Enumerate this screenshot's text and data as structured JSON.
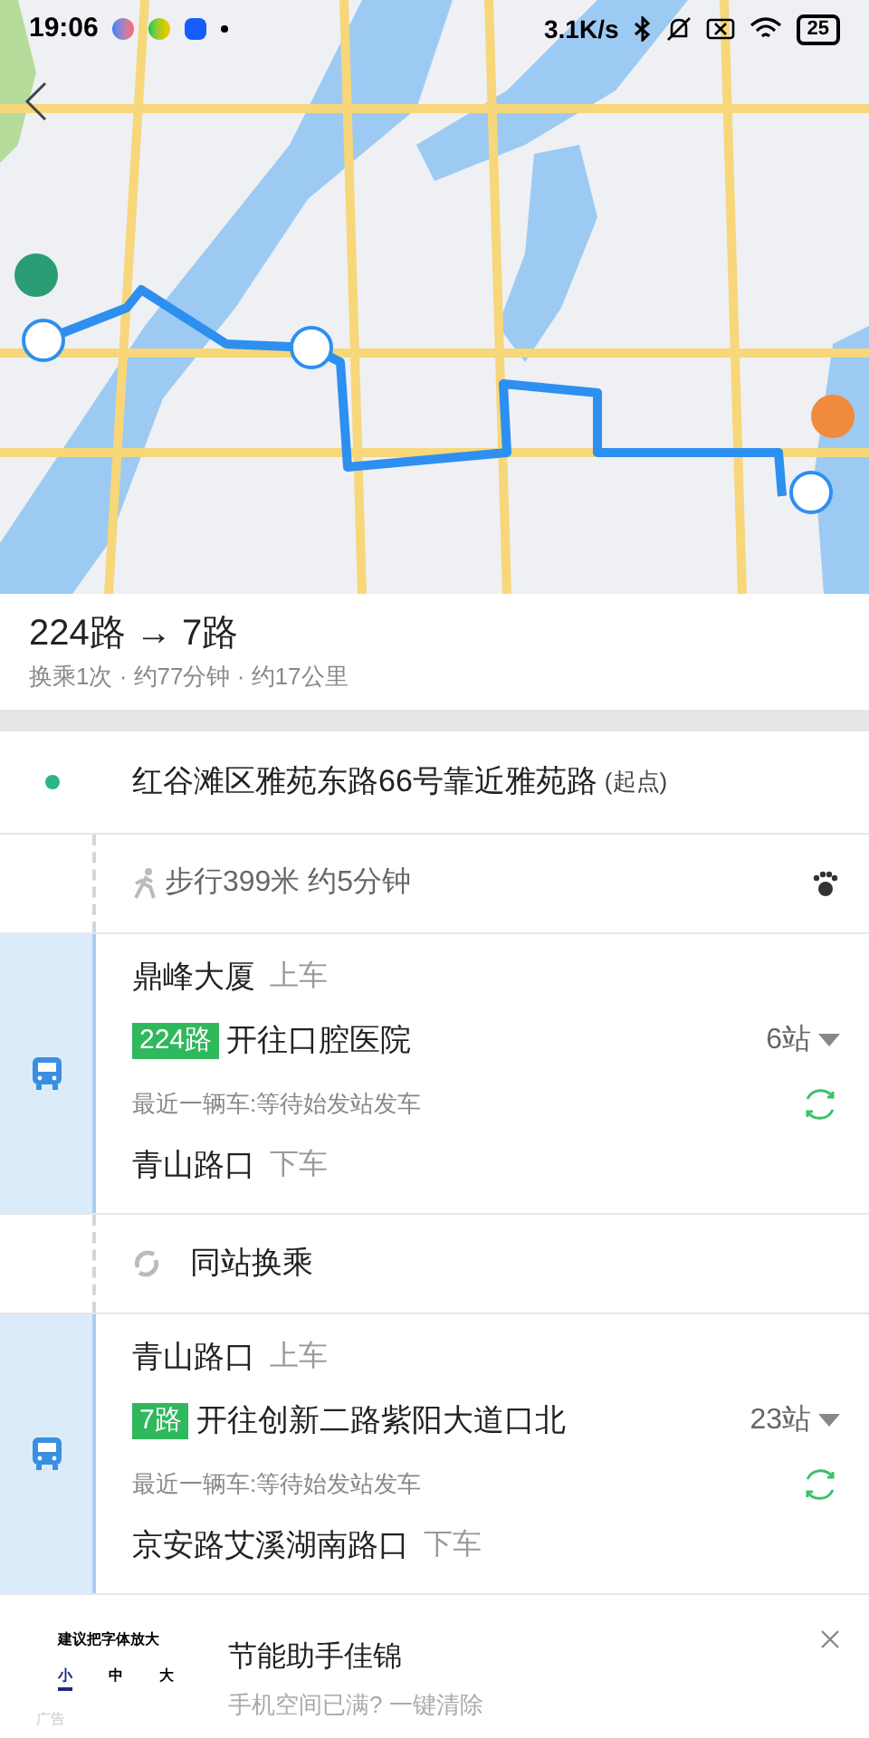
{
  "status_bar": {
    "time": "19:06",
    "net_speed": "3.1K/s",
    "battery": "25"
  },
  "route": {
    "title": "224路 → 7路",
    "summary": "换乘1次 · 约77分钟 · 约17公里"
  },
  "steps": [
    {
      "kind": "start",
      "address": "红谷滩区雅苑东路66号靠近雅苑路",
      "tag": "(起点)"
    },
    {
      "kind": "walk",
      "text": "步行399米 约5分钟"
    },
    {
      "kind": "bus",
      "board_stop": "鼎峰大厦",
      "board_label": "上车",
      "line": "224路",
      "direction": "开往口腔医院",
      "stops": "6站",
      "next_bus": "最近一辆车:等待始发站发车",
      "alight_stop": "青山路口",
      "alight_label": "下车"
    },
    {
      "kind": "transfer",
      "text": "同站换乘"
    },
    {
      "kind": "bus",
      "board_stop": "青山路口",
      "board_label": "上车",
      "line": "7路",
      "direction": "开往创新二路紫阳大道口北",
      "stops": "23站",
      "next_bus": "最近一辆车:等待始发站发车",
      "alight_stop": "京安路艾溪湖南路口",
      "alight_label": "下车"
    }
  ],
  "ad": {
    "thumbnail": {
      "caption": "建议把字体放大",
      "options": [
        {
          "label": "小",
          "selected": true
        },
        {
          "label": "中",
          "selected": false
        },
        {
          "label": "大",
          "selected": false
        }
      ]
    },
    "ad_label": "广告",
    "title": "节能助手佳锦",
    "subtitle": "手机空间已满? 一键清除"
  }
}
